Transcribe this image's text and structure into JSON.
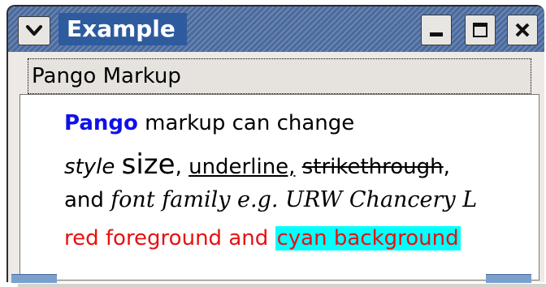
{
  "window": {
    "title": "Example",
    "menu_icon": "chevron-down-icon",
    "buttons": {
      "minimize_icon": "minimize-icon",
      "maximize_icon": "maximize-icon",
      "close_icon": "close-icon"
    },
    "titlebar_color": "#4a6a9e"
  },
  "frame": {
    "label": "Pango Markup"
  },
  "markup": {
    "line1": {
      "pango": "Pango",
      "rest": " markup can change"
    },
    "line2": {
      "style": "style",
      "size": "size",
      "comma": ",",
      "underline": "underline,",
      "strike": "strikethrough",
      "trailing": ","
    },
    "line3": {
      "and": "and ",
      "fancy": "font family e.g. URW Chancery L"
    },
    "line4": {
      "red": "red foreground and ",
      "cyan": "cyan background"
    }
  },
  "colors": {
    "pango_blue": "#1010e8",
    "red_text": "#e81010",
    "cyan_bg": "#00ffff"
  }
}
